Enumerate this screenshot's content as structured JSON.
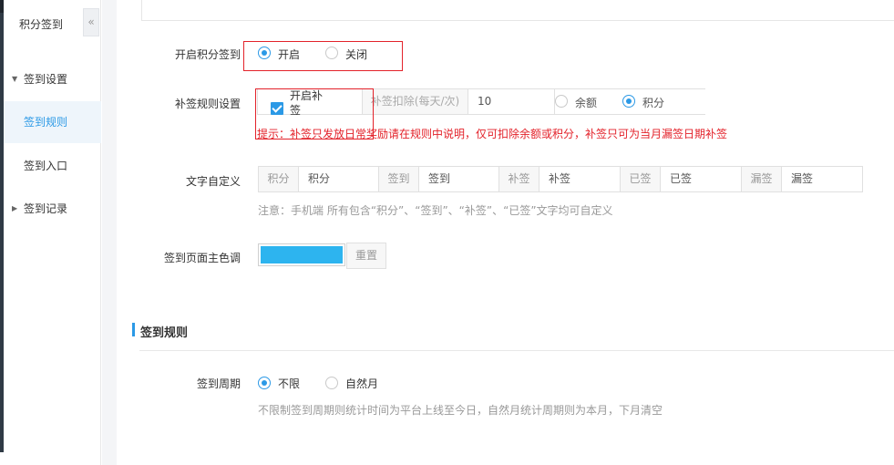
{
  "sidebar": {
    "title": "积分签到",
    "collapse_glyph": "«",
    "groups": [
      {
        "label": "签到设置",
        "expanded": true,
        "items": [
          {
            "label": "签到规则",
            "active": true
          },
          {
            "label": "签到入口",
            "active": false
          }
        ]
      },
      {
        "label": "签到记录",
        "expanded": false
      }
    ]
  },
  "form": {
    "enable_sign": {
      "label": "开启积分签到",
      "options": [
        {
          "label": "开启",
          "selected": true
        },
        {
          "label": "关闭",
          "selected": false
        }
      ]
    },
    "makeup": {
      "label": "补签规则设置",
      "checkbox_label_line1": "开启补",
      "checkbox_label_line2": "签",
      "checked": true,
      "deduct_placeholder": "补签扣除(每天/次)",
      "deduct_value": "10",
      "options": [
        {
          "label": "余额",
          "selected": false
        },
        {
          "label": "积分",
          "selected": true
        }
      ],
      "hint": "提示：补签只发放日常奖励请在规则中说明，仅可扣除余额或积分，补签只可为当月漏签日期补签"
    },
    "text_custom": {
      "label": "文字自定义",
      "pairs": [
        {
          "addon": "积分",
          "value": "积分"
        },
        {
          "addon": "签到",
          "value": "签到"
        },
        {
          "addon": "补签",
          "value": "补签"
        },
        {
          "addon": "已签",
          "value": "已签"
        },
        {
          "addon": "漏签",
          "value": "漏签"
        }
      ],
      "note": "注意：手机端 所有包含“积分”、“签到”、“补签”、“已签”文字均可自定义"
    },
    "theme_color": {
      "label": "签到页面主色调",
      "color": "#2db4ef",
      "reset_label": "重置"
    }
  },
  "rules_section": {
    "title": "签到规则",
    "period": {
      "label": "签到周期",
      "options": [
        {
          "label": "不限",
          "selected": true
        },
        {
          "label": "自然月",
          "selected": false
        }
      ],
      "note": "不限制签到周期则统计时间为平台上线至今日，自然月统计周期则为本月，下月清空"
    }
  },
  "colors": {
    "accent": "#2b99e6",
    "highlight_box": "#e3222a",
    "hint_red": "#e3222a"
  }
}
